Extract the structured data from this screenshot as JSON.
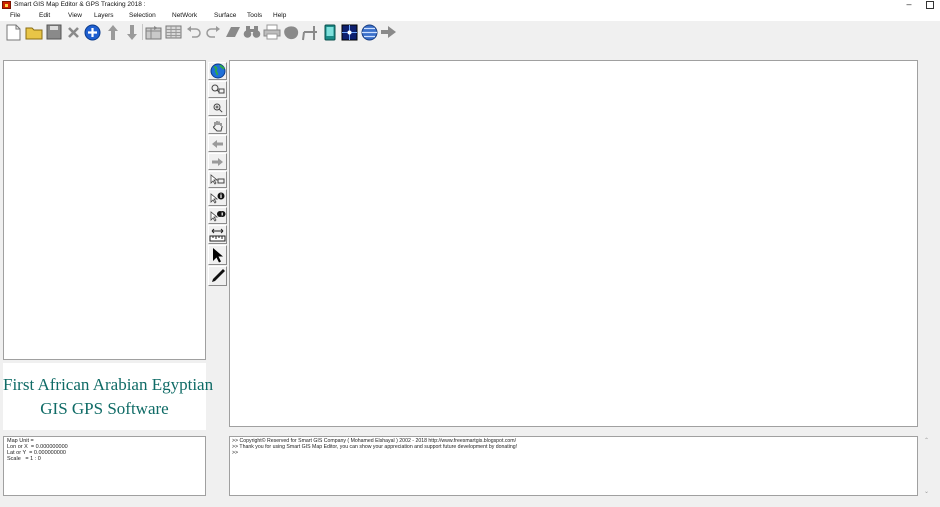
{
  "window": {
    "title": "Smart GIS Map Editor & GPS Tracking 2018 :",
    "minimize_glyph": "–"
  },
  "menu": [
    "File",
    "Edit",
    "View",
    "Layers",
    "Selection",
    "NetWork",
    "Surface",
    "Tools",
    "Help"
  ],
  "toolbar": {
    "buttons": [
      "new-file",
      "open-folder",
      "save",
      "delete",
      "add-point",
      "move-up",
      "move-down",
      "import-table",
      "table",
      "undo",
      "redo",
      "eraser",
      "find-binoculars",
      "print",
      "shape",
      "route",
      "gps-device",
      "map-grid",
      "globe-layers",
      "export"
    ]
  },
  "side_tools": [
    "world-map",
    "zoom-window",
    "zoom-in",
    "pan",
    "previous-extent",
    "next-extent",
    "select-to-layer",
    "identify",
    "identify-all",
    "measure",
    "select-arrow",
    "edit-pencil"
  ],
  "brand": {
    "line1": "First African Arabian Egyptian",
    "line2": "GIS GPS Software",
    "color": "#0f6b66"
  },
  "info": {
    "map_unit": "Map Unit =",
    "lon": "Lon or X  = 0.000000000",
    "lat": "Lat or Y  = 0.000000000",
    "scale": "Scale   = 1 : 0"
  },
  "log": {
    "line1": ">>  Copyright© Reserved for Smart GIS Company ( Mohamed Elshayal ) 2002 - 2018  http://www.freesmartgis.blogspot.com/",
    "line2": ">>  Thank you for using Smart GIS Map Editor, you can show your appreciation and support future development by donating!",
    "line3": ">>"
  },
  "colors": {
    "window_bg": "#f0f0f0",
    "panel_bg": "#ffffff",
    "panel_border": "#a0a0a0"
  }
}
